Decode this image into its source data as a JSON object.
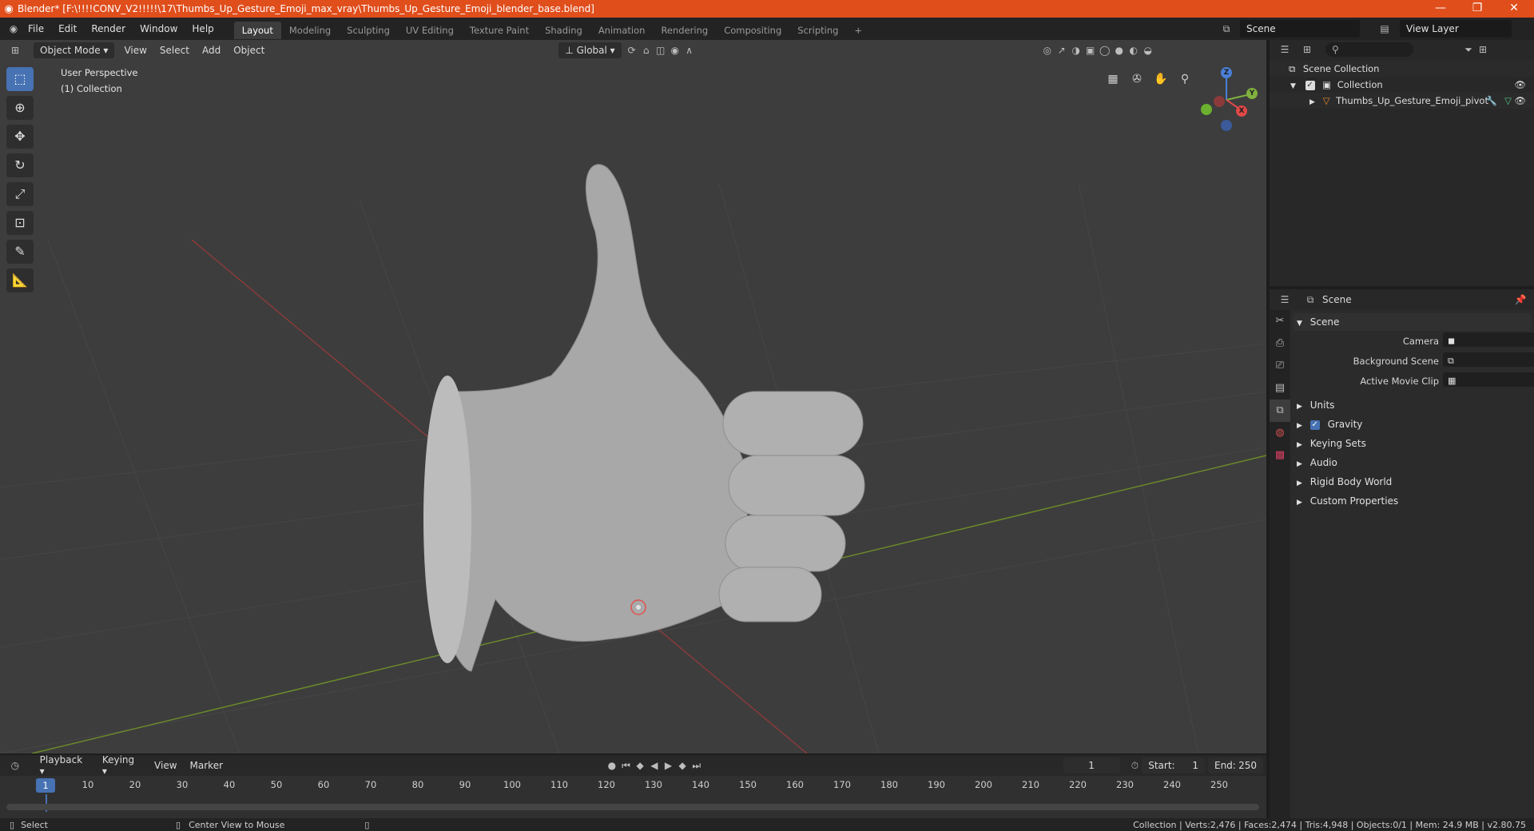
{
  "window": {
    "title": "Blender* [F:\\!!!!CONV_V2!!!!!\\17\\Thumbs_Up_Gesture_Emoji_max_vray\\Thumbs_Up_Gesture_Emoji_blender_base.blend]",
    "minimize": "—",
    "maximize": "❐",
    "close": "✕"
  },
  "menu": [
    "File",
    "Edit",
    "Render",
    "Window",
    "Help"
  ],
  "workspaces": [
    "Layout",
    "Modeling",
    "Sculpting",
    "UV Editing",
    "Texture Paint",
    "Shading",
    "Animation",
    "Rendering",
    "Compositing",
    "Scripting"
  ],
  "add_workspace": "+",
  "scene_selector": "Scene",
  "view_layer": "View Layer",
  "viewport": {
    "mode": "Object Mode",
    "menus": [
      "View",
      "Select",
      "Add",
      "Object"
    ],
    "orientation": "Global",
    "perspective_label": "User Perspective",
    "collection_label": "(1) Collection",
    "gizmo": {
      "z": "Z",
      "y": "Y",
      "x": "X"
    }
  },
  "timeline": {
    "menus": [
      "Playback",
      "Keying",
      "View",
      "Marker"
    ],
    "current_frame": "1",
    "start_label": "Start:",
    "start": "1",
    "end_label": "End:",
    "end": "250",
    "ticks": [
      "1",
      "10",
      "20",
      "30",
      "40",
      "50",
      "60",
      "70",
      "80",
      "90",
      "100",
      "110",
      "120",
      "130",
      "140",
      "150",
      "160",
      "170",
      "180",
      "190",
      "200",
      "210",
      "220",
      "230",
      "240",
      "250"
    ]
  },
  "outliner": {
    "scene_collection": "Scene Collection",
    "collection": "Collection",
    "object": "Thumbs_Up_Gesture_Emoji_pivot"
  },
  "properties": {
    "header": "Scene",
    "panel_title": "Scene",
    "camera_label": "Camera",
    "background_scene_label": "Background Scene",
    "active_movie_clip_label": "Active Movie Clip",
    "sections": [
      "Units",
      "Gravity",
      "Keying Sets",
      "Audio",
      "Rigid Body World",
      "Custom Properties"
    ]
  },
  "status": {
    "select": "Select",
    "center_view": "Center View to Mouse",
    "stats": "Collection | Verts:2,476 | Faces:2,474 | Tris:4,948 | Objects:0/1 | Mem: 24.9 MB | v2.80.75"
  }
}
